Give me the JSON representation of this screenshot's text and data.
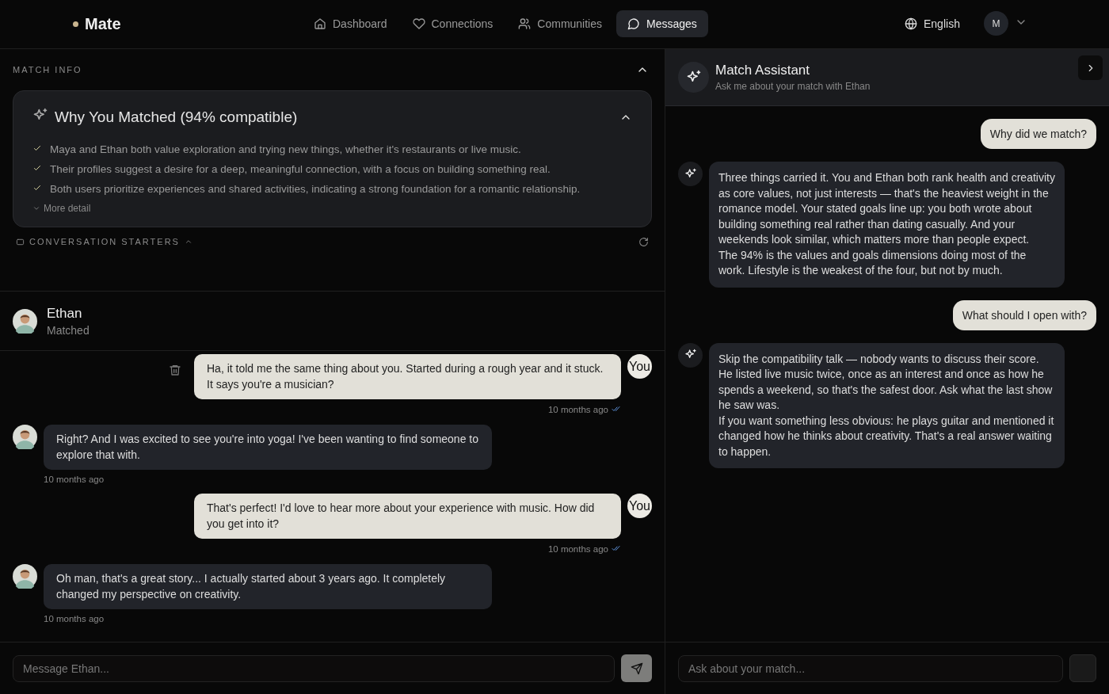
{
  "nav": {
    "brand": "Mate",
    "items": [
      {
        "label": "Dashboard",
        "selected": false
      },
      {
        "label": "Connections",
        "selected": false
      },
      {
        "label": "Communities",
        "selected": false
      },
      {
        "label": "Messages",
        "selected": true
      }
    ],
    "language": "English",
    "avatar": "M"
  },
  "match_info": {
    "label": "MATCH INFO",
    "expanded": true,
    "card": {
      "title": "Why You Matched (94% compatible)",
      "expanded": true,
      "reasons": [
        "Maya and Ethan both value exploration and trying new things, whether it's restaurants or live music.",
        "Their profiles suggest a desire for a deep, meaningful connection, with a focus on building something real.",
        "Both users prioritize experiences and shared activities, indicating a strong foundation for a romantic relationship."
      ],
      "more": "More detail"
    },
    "starters": {
      "label": "CONVERSATION STARTERS",
      "expanded": false
    }
  },
  "chat": {
    "contact": {
      "name": "Ethan",
      "status": "Matched"
    },
    "messages": [
      {
        "kind": "sent",
        "avatar": "You",
        "text": "Ha, it told me the same thing about you. Started during a rough year and it stuck. It says you're a musician?",
        "time": "10 months ago",
        "read": true
      },
      {
        "kind": "received",
        "text": "Right? And I was excited to see you're into yoga! I've been wanting to find someone to explore that with.",
        "time": "10 months ago"
      },
      {
        "kind": "sent",
        "avatar": "You",
        "text": "That's perfect! I'd love to hear more about your experience with music. How did you get into it?",
        "time": "10 months ago",
        "read": true
      },
      {
        "kind": "received",
        "text": "Oh man, that's a great story... I actually started about 3 years ago. It completely changed my perspective on creativity.",
        "time": "10 months ago"
      }
    ],
    "placeholder": "Message Ethan..."
  },
  "assistant": {
    "title": "Match Assistant",
    "subtitle": "Ask me about your match with Ethan",
    "messages": [
      {
        "kind": "question",
        "text": "Why did we match?"
      },
      {
        "kind": "answer",
        "text": "Three things carried it. You and Ethan both rank health and creativity as core values, not just interests — that's the heaviest weight in the romance model. Your stated goals line up: you both wrote about building something real rather than dating casually. And your weekends look similar, which matters more than people expect.\nThe 94% is the values and goals dimensions doing most of the work. Lifestyle is the weakest of the four, but not by much."
      },
      {
        "kind": "question",
        "text": "What should I open with?"
      },
      {
        "kind": "answer",
        "text": "Skip the compatibility talk — nobody wants to discuss their score. He listed live music twice, once as an interest and once as how he spends a weekend, so that's the safest door. Ask what the last show he saw was.\nIf you want something less obvious: he plays guitar and mentioned it changed how he thinks about creativity. That's a real answer waiting to happen."
      }
    ],
    "placeholder": "Ask about your match..."
  }
}
